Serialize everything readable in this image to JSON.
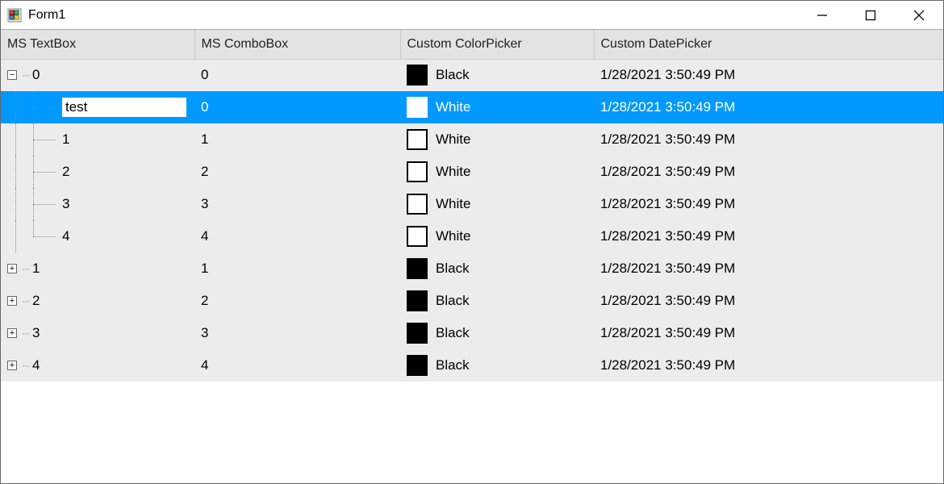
{
  "window": {
    "title": "Form1"
  },
  "columns": {
    "c1": "MS TextBox",
    "c2": "MS ComboBox",
    "c3": "Custom ColorPicker",
    "c4": "Custom DatePicker"
  },
  "rows": [
    {
      "indent": 0,
      "expander": "minus",
      "isLast": false,
      "label": "0",
      "combobox": "0",
      "color": "Black",
      "swatch": "black",
      "date": "1/28/2021 3:50:49 PM",
      "selected": false,
      "editing": false
    },
    {
      "indent": 1,
      "expander": null,
      "isLast": false,
      "label": "test",
      "combobox": "0",
      "color": "White",
      "swatch": "white",
      "date": "1/28/2021 3:50:49 PM",
      "selected": true,
      "editing": true
    },
    {
      "indent": 1,
      "expander": null,
      "isLast": false,
      "label": "1",
      "combobox": "1",
      "color": "White",
      "swatch": "white",
      "date": "1/28/2021 3:50:49 PM",
      "selected": false,
      "editing": false
    },
    {
      "indent": 1,
      "expander": null,
      "isLast": false,
      "label": "2",
      "combobox": "2",
      "color": "White",
      "swatch": "white",
      "date": "1/28/2021 3:50:49 PM",
      "selected": false,
      "editing": false
    },
    {
      "indent": 1,
      "expander": null,
      "isLast": false,
      "label": "3",
      "combobox": "3",
      "color": "White",
      "swatch": "white",
      "date": "1/28/2021 3:50:49 PM",
      "selected": false,
      "editing": false
    },
    {
      "indent": 1,
      "expander": null,
      "isLast": true,
      "label": "4",
      "combobox": "4",
      "color": "White",
      "swatch": "white",
      "date": "1/28/2021 3:50:49 PM",
      "selected": false,
      "editing": false
    },
    {
      "indent": 0,
      "expander": "plus",
      "isLast": false,
      "label": "1",
      "combobox": "1",
      "color": "Black",
      "swatch": "black",
      "date": "1/28/2021 3:50:49 PM",
      "selected": false,
      "editing": false
    },
    {
      "indent": 0,
      "expander": "plus",
      "isLast": false,
      "label": "2",
      "combobox": "2",
      "color": "Black",
      "swatch": "black",
      "date": "1/28/2021 3:50:49 PM",
      "selected": false,
      "editing": false
    },
    {
      "indent": 0,
      "expander": "plus",
      "isLast": false,
      "label": "3",
      "combobox": "3",
      "color": "Black",
      "swatch": "black",
      "date": "1/28/2021 3:50:49 PM",
      "selected": false,
      "editing": false
    },
    {
      "indent": 0,
      "expander": "plus",
      "isLast": true,
      "label": "4",
      "combobox": "4",
      "color": "Black",
      "swatch": "black",
      "date": "1/28/2021 3:50:49 PM",
      "selected": false,
      "editing": false
    }
  ]
}
